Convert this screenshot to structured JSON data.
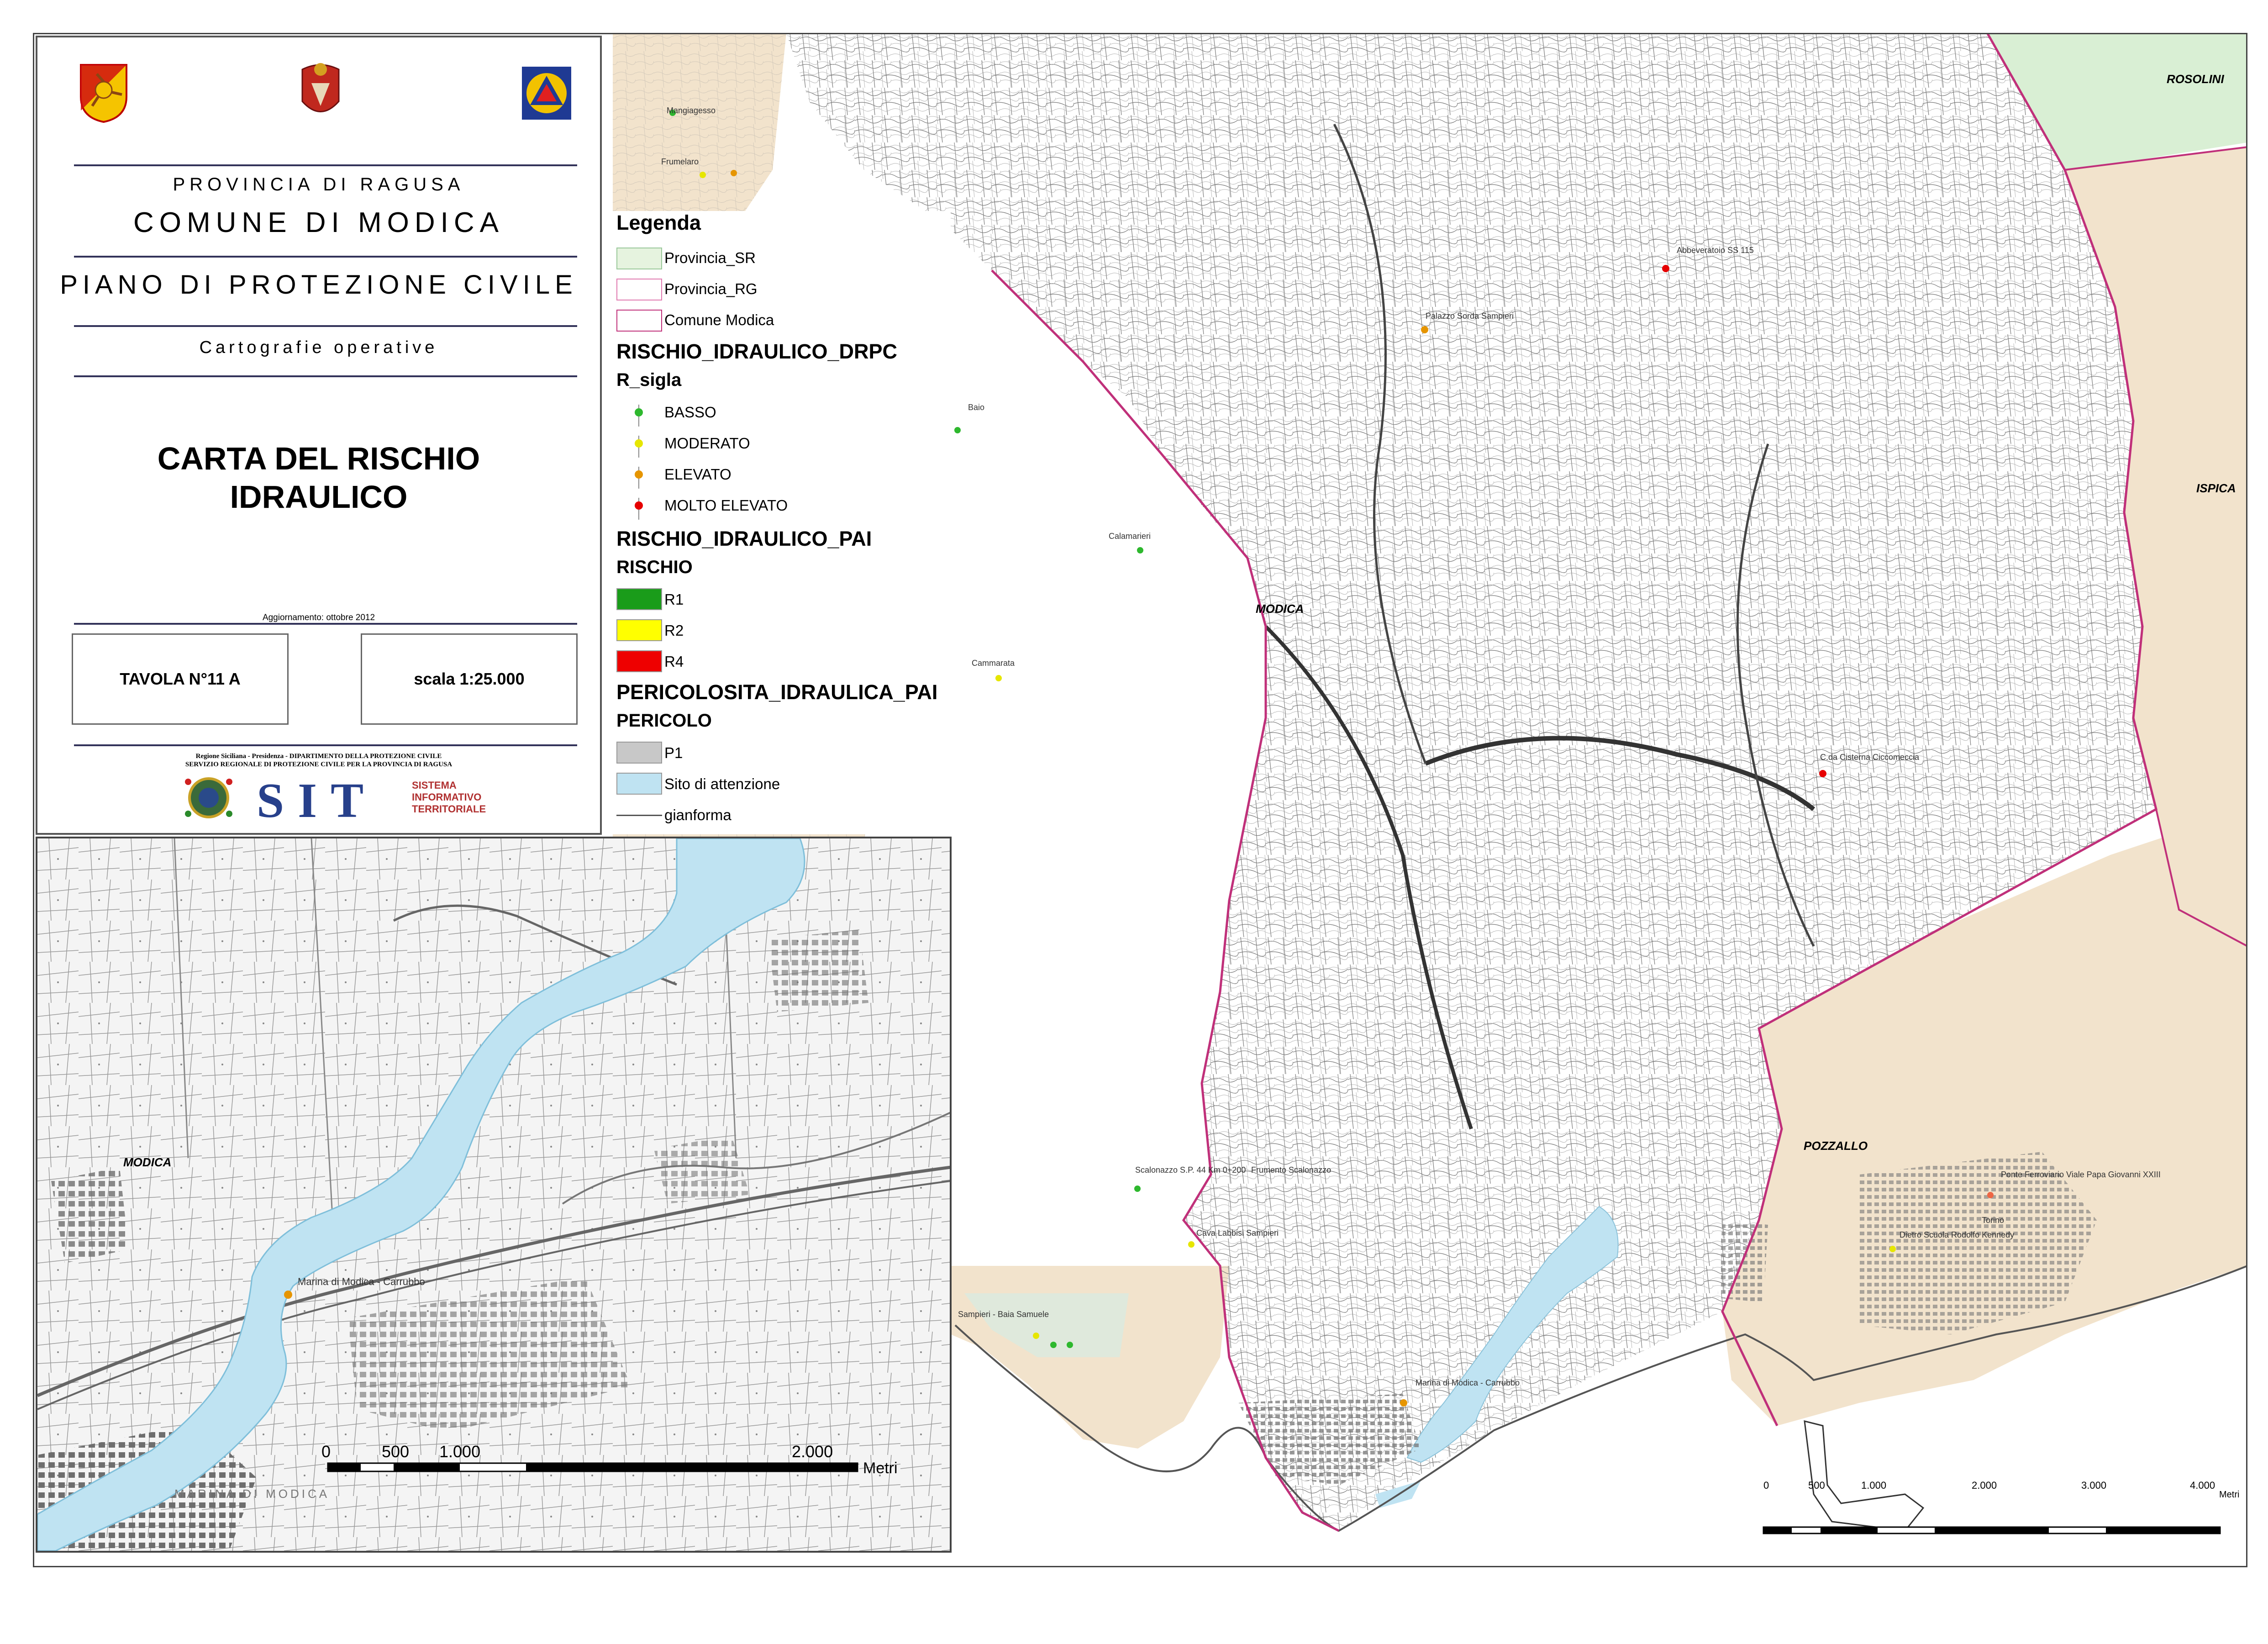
{
  "title_block": {
    "provincia": "PROVINCIA DI RAGUSA",
    "comune": "COMUNE DI MODICA",
    "piano": "PIANO DI PROTEZIONE CIVILE",
    "cartografie": "Cartografie operative",
    "carta_line1": "CARTA DEL RISCHIO",
    "carta_line2": "IDRAULICO",
    "aggiornamento": "Aggiornamento: ottobre 2012",
    "tavola": "TAVOLA N°11 A",
    "scala": "scala 1:25.000",
    "regione_line1": "Regione Siciliana - Presidenza - DIPARTIMENTO DELLA PROTEZIONE CIVILE",
    "regione_line2": "SERVIZIO REGIONALE DI PROTEZIONE CIVILE PER LA PROVINCIA DI RAGUSA",
    "sit": "SIT",
    "sit_sub1": "SISTEMA",
    "sit_sub2": "INFORMATIVO",
    "sit_sub3": "TERRITORIALE"
  },
  "legend": {
    "title": "Legenda",
    "boundaries": [
      "Provincia_SR",
      "Provincia_RG",
      "Comune Modica"
    ],
    "drpc_head": "RISCHIO_IDRAULICO_DRPC",
    "drpc_sub": "R_sigla",
    "drpc_items": [
      {
        "label": "BASSO",
        "color": "#2eb82e"
      },
      {
        "label": "MODERATO",
        "color": "#e6e600"
      },
      {
        "label": "ELEVATO",
        "color": "#e69500"
      },
      {
        "label": "MOLTO ELEVATO",
        "color": "#e60000"
      }
    ],
    "pai_head": "RISCHIO_IDRAULICO_PAI",
    "pai_sub": "RISCHIO",
    "pai_items": [
      {
        "label": "R1",
        "color": "#1a9c1a"
      },
      {
        "label": "R2",
        "color": "#ffff00"
      },
      {
        "label": "R4",
        "color": "#ee0000"
      }
    ],
    "per_head": "PERICOLOSITA_IDRAULICA_PAI",
    "per_sub": "PERICOLO",
    "per_items": [
      {
        "label": "P1",
        "color": "#c8c8c8"
      },
      {
        "label": "Sito di attenzione",
        "color": "#bfe3f2"
      }
    ],
    "gianforma": "gianforma"
  },
  "main_map": {
    "labels": {
      "rosolini": "ROSOLINI",
      "ispica": "ISPICA",
      "modica": "MODICA",
      "pozzallo": "POZZALLO"
    },
    "sites": [
      "Mangiagesso",
      "Frumelaro",
      "Abbeveratoio SS 115",
      "Palazzo Sorda Sampieri",
      "Baio",
      "Calamarieri",
      "Cammarata",
      "C.da Cisterna Ciccomeccia",
      "Scalonazzo S.P. 44 Km 0+200",
      "Frumento Scalonazzo",
      "Cava Labbisi Sampieri",
      "Sampieri - Baia Samuele",
      "Marina di Modica - Carrubbo",
      "Ponte Ferroviario Viale Papa Giovanni XXIII",
      "Torino",
      "Dietro Scuola Rodolfo Kennedy",
      "POZZALLO"
    ],
    "scale": {
      "ticks": [
        "0",
        "500",
        "1.000",
        "2.000",
        "3.000",
        "4.000"
      ],
      "unit": "Metri"
    }
  },
  "inset_map": {
    "label_modica": "MODICA",
    "site": "Marina di Modica - Carrubbo",
    "marina": "MARINA DI MODICA",
    "scale": {
      "ticks": [
        "0",
        "500",
        "1.000",
        "2.000"
      ],
      "unit": "Metri"
    }
  },
  "colors": {
    "tan_region": "#f2e3cc",
    "green_region": "#d9efd4",
    "flood_zone": "#bfe3f2",
    "boundary": "#c0307a",
    "urban": "#888888"
  }
}
